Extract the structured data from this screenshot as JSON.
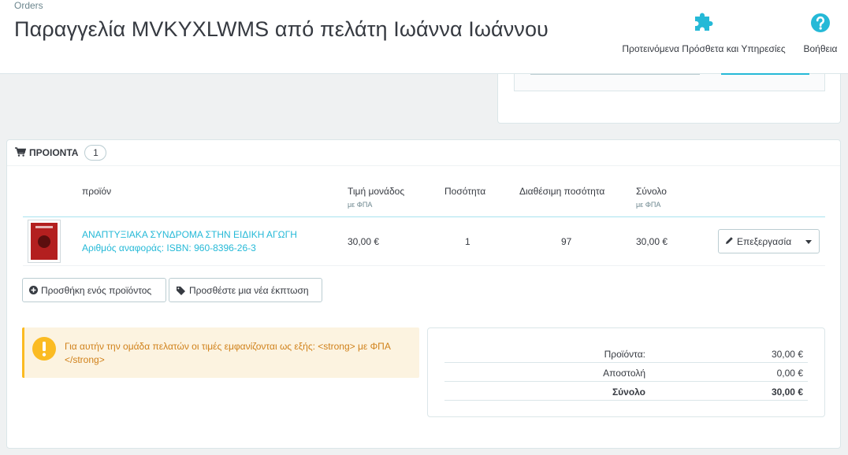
{
  "header": {
    "breadcrumb": "Orders",
    "title": "Παραγγελία MVKYXLWMS από πελάτη Ιωάννα Ιωάννου",
    "addons_label": "Προτεινόμενα Πρόσθετα και Υπηρεσίες",
    "help_label": "Βοήθεια",
    "addons_icon": "puzzle-icon",
    "help_icon": "question-circle-icon",
    "accent": "#25b9d7"
  },
  "products": {
    "heading": "ΠΡΟΙΟΝΤΑ",
    "count": "1",
    "columns": {
      "product": "προϊόν",
      "unit_price": "Τιμή μονάδος",
      "unit_price_sub": "με ΦΠΑ",
      "quantity": "Ποσότητα",
      "available": "Διαθέσιμη ποσότητα",
      "total": "Σύνολο",
      "total_sub": "με ΦΠΑ"
    },
    "rows": [
      {
        "name": "ΑΝΑΠΤΥΞΙΑΚΑ ΣΥΝΔΡΟΜΑ ΣΤΗΝ ΕΙΔΙΚΗ ΑΓΩΓΗ",
        "reference": "Αριθμός αναφοράς: ISBN: 960-8396-26-3",
        "unit_price": "30,00 €",
        "quantity": "1",
        "available": "97",
        "total": "30,00 €",
        "edit_label": "Επεξεργασία"
      }
    ],
    "add_product_label": "Προσθήκη ενός προϊόντος",
    "add_discount_label": "Προσθέστε μια νέα έκπτωση"
  },
  "alert": {
    "text": "Για αυτήν την ομάδα πελατών οι τιμές εμφανίζονται ως εξής: <strong> με ΦΠΑ </strong>",
    "color": "#fbbb22"
  },
  "totals": {
    "products_label": "Προϊόντα:",
    "products_value": "30,00 €",
    "shipping_label": "Αποστολή",
    "shipping_value": "0,00 €",
    "total_label": "Σύνολο",
    "total_value": "30,00 €"
  }
}
